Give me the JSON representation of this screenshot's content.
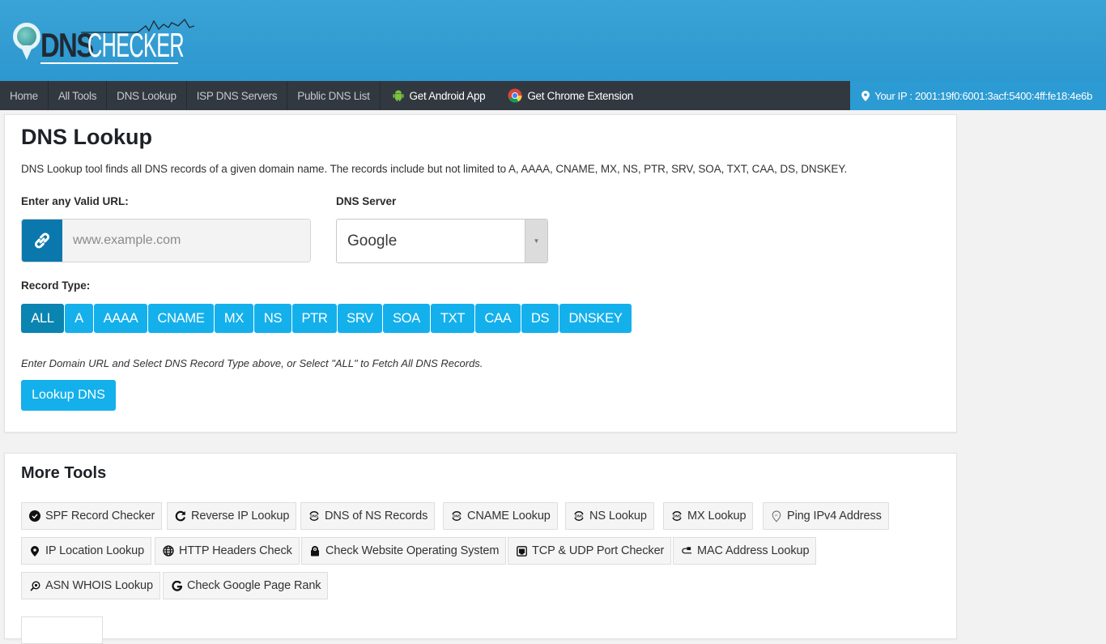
{
  "header": {
    "logo": {
      "part1": "DNS",
      "part2": "CHECKER"
    }
  },
  "nav": {
    "items": [
      {
        "label": "Home"
      },
      {
        "label": "All Tools"
      },
      {
        "label": "DNS Lookup"
      },
      {
        "label": "ISP DNS Servers"
      },
      {
        "label": "Public DNS List"
      },
      {
        "label": "Get Android App",
        "icon": "android-icon"
      },
      {
        "label": "Get Chrome Extension",
        "icon": "chrome-icon"
      }
    ],
    "ip": {
      "label": "Your IP : 2001:19f0:6001:3acf:5400:4ff:fe18:4e6b",
      "icon": "map-marker-icon"
    }
  },
  "colors": {
    "header_blue": "#2d97cf",
    "nav_dark": "#323840",
    "accent": "#14b0ec",
    "accent_active": "#0a84b0",
    "addon_blue": "#0b78ad"
  },
  "main": {
    "title": "DNS Lookup",
    "description": "DNS Lookup tool finds all DNS records of a given domain name. The records include but not limited to A, AAAA, CNAME, MX, NS, PTR, SRV, SOA, TXT, CAA, DS, DNSKEY.",
    "url_label": "Enter any Valid URL:",
    "url_input": {
      "value": "",
      "placeholder": "www.example.com"
    },
    "server_label": "DNS Server",
    "server_selected": "Google",
    "record_label": "Record Type:",
    "record_types": [
      {
        "label": "ALL",
        "active": true
      },
      {
        "label": "A"
      },
      {
        "label": "AAAA"
      },
      {
        "label": "CNAME"
      },
      {
        "label": "MX"
      },
      {
        "label": "NS"
      },
      {
        "label": "PTR"
      },
      {
        "label": "SRV"
      },
      {
        "label": "SOA"
      },
      {
        "label": "TXT"
      },
      {
        "label": "CAA"
      },
      {
        "label": "DS"
      },
      {
        "label": "DNSKEY"
      }
    ],
    "hint": "Enter Domain URL and Select DNS Record Type above, or Select \"ALL\" to Fetch All DNS Records.",
    "lookup_button": "Lookup DNS"
  },
  "more_tools": {
    "title": "More Tools",
    "items": [
      {
        "label": "SPF Record Checker",
        "icon": "check-circle-icon"
      },
      {
        "label": "Reverse IP Lookup",
        "icon": "refresh-icon"
      },
      {
        "label": "DNS of NS Records",
        "icon": "dns-icon"
      },
      {
        "label": "CNAME Lookup",
        "icon": "dns-icon"
      },
      {
        "label": "NS Lookup",
        "icon": "dns-icon"
      },
      {
        "label": "MX Lookup",
        "icon": "dns-icon"
      },
      {
        "label": "Ping IPv4 Address",
        "icon": "ip-marker-icon"
      },
      {
        "label": "IP Location Lookup",
        "icon": "map-marker-icon"
      },
      {
        "label": "HTTP Headers Check",
        "icon": "globe-icon"
      },
      {
        "label": "Check Website Operating System",
        "icon": "os-icon"
      },
      {
        "label": "TCP & UDP Port Checker",
        "icon": "port-icon"
      },
      {
        "label": "MAC Address Lookup",
        "icon": "cable-icon"
      },
      {
        "label": "ASN WHOIS Lookup",
        "icon": "search-icon"
      },
      {
        "label": "Check Google Page Rank",
        "icon": "google-icon"
      }
    ]
  }
}
